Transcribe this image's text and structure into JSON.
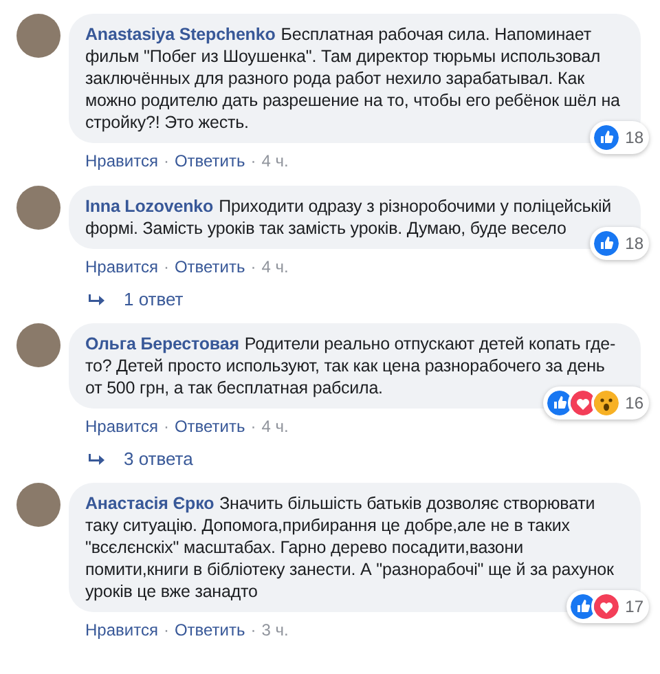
{
  "separator": "·",
  "comments": [
    {
      "author": "Anastasiya Stepchenko",
      "text": "Бесплатная рабочая сила. Напоминает фильм \"Побег из Шоушенка\". Там директор тюрьмы использовал заключённых для разного рода работ нехило зарабатывал. Как можно родителю дать разрешение на то, чтобы его ребёнок шёл на стройку?! Это жесть.",
      "reactions": [
        {
          "kind": "like"
        }
      ],
      "reaction_count": "18",
      "like": "Нравится",
      "reply": "Ответить",
      "time": "4 ч."
    },
    {
      "author": "Inna Lozovenko",
      "text": "Приходити одразу з різноробочими у поліцейській формі. Замість уроків так замість уроків. Думаю, буде весело",
      "reactions": [
        {
          "kind": "like"
        }
      ],
      "reaction_count": "18",
      "like": "Нравится",
      "reply": "Ответить",
      "time": "4 ч.",
      "replies": "1 ответ"
    },
    {
      "author": "Ольга Берестовая",
      "text": "Родители реально отпускают детей копать где-то? Детей просто используют, так как цена разнорабочего за день от 500 грн, а так бесплатная рабсила.",
      "reactions": [
        {
          "kind": "like"
        },
        {
          "kind": "love"
        },
        {
          "kind": "wow"
        }
      ],
      "reaction_count": "16",
      "like": "Нравится",
      "reply": "Ответить",
      "time": "4 ч.",
      "replies": "3 ответа"
    },
    {
      "author": "Анастасія Єрко",
      "text": "Значить більшість батьків дозволяє створювати таку ситуацію. Допомога,прибирання це добре,але не в таких \"всєлєнскіх\" масштабах. Гарно дерево посадити,вазони помити,книги в бібліотеку занести. А \"разнорабочі\" ще й за рахунок уроків це вже занадто",
      "reactions": [
        {
          "kind": "like"
        },
        {
          "kind": "love"
        }
      ],
      "reaction_count": "17",
      "like": "Нравится",
      "reply": "Ответить",
      "time": "3 ч."
    }
  ]
}
